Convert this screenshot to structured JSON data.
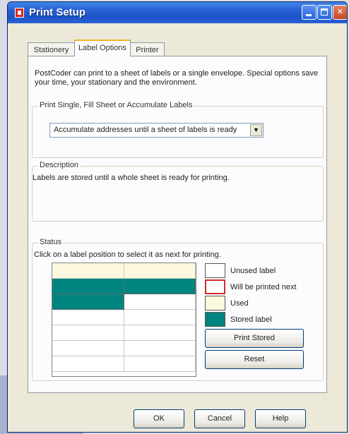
{
  "window": {
    "title": "Print Setup"
  },
  "tabs": [
    "Stationery",
    "Label Options",
    "Printer"
  ],
  "intro": "PostCoder can print to a sheet of labels or a single envelope. Special options save your time, your stationary and the environment.",
  "print_group": {
    "title": "Print Single, Fill Sheet or Accumulate Labels",
    "selected": "Accumulate addresses until a sheet of labels is ready"
  },
  "description": {
    "title": "Description",
    "text": "Labels are stored until a whole sheet is ready for printing."
  },
  "status": {
    "title": "Status",
    "hint": "Click on a label position to select it as next for printing.",
    "legend": [
      {
        "label": "Unused label",
        "state": "unused"
      },
      {
        "label": "Will be printed next",
        "state": "next"
      },
      {
        "label": "Used",
        "state": "used"
      },
      {
        "label": "Stored label",
        "state": "stored"
      }
    ],
    "grid_rows": [
      [
        "used",
        "used"
      ],
      [
        "stored",
        "stored"
      ],
      [
        "stored",
        "unused"
      ],
      [
        "unused",
        "unused"
      ],
      [
        "unused",
        "unused"
      ],
      [
        "unused",
        "unused"
      ],
      [
        "unused",
        "unused"
      ]
    ],
    "print_stored_label": "Print Stored",
    "reset_label": "Reset"
  },
  "buttons": {
    "ok": "OK",
    "cancel": "Cancel",
    "help": "Help"
  },
  "colors": {
    "unused": "#ffffff",
    "used": "#fdf9de",
    "stored": "#00847f",
    "next_border": "#d42a2a",
    "title_bar": "#2a63d6"
  }
}
